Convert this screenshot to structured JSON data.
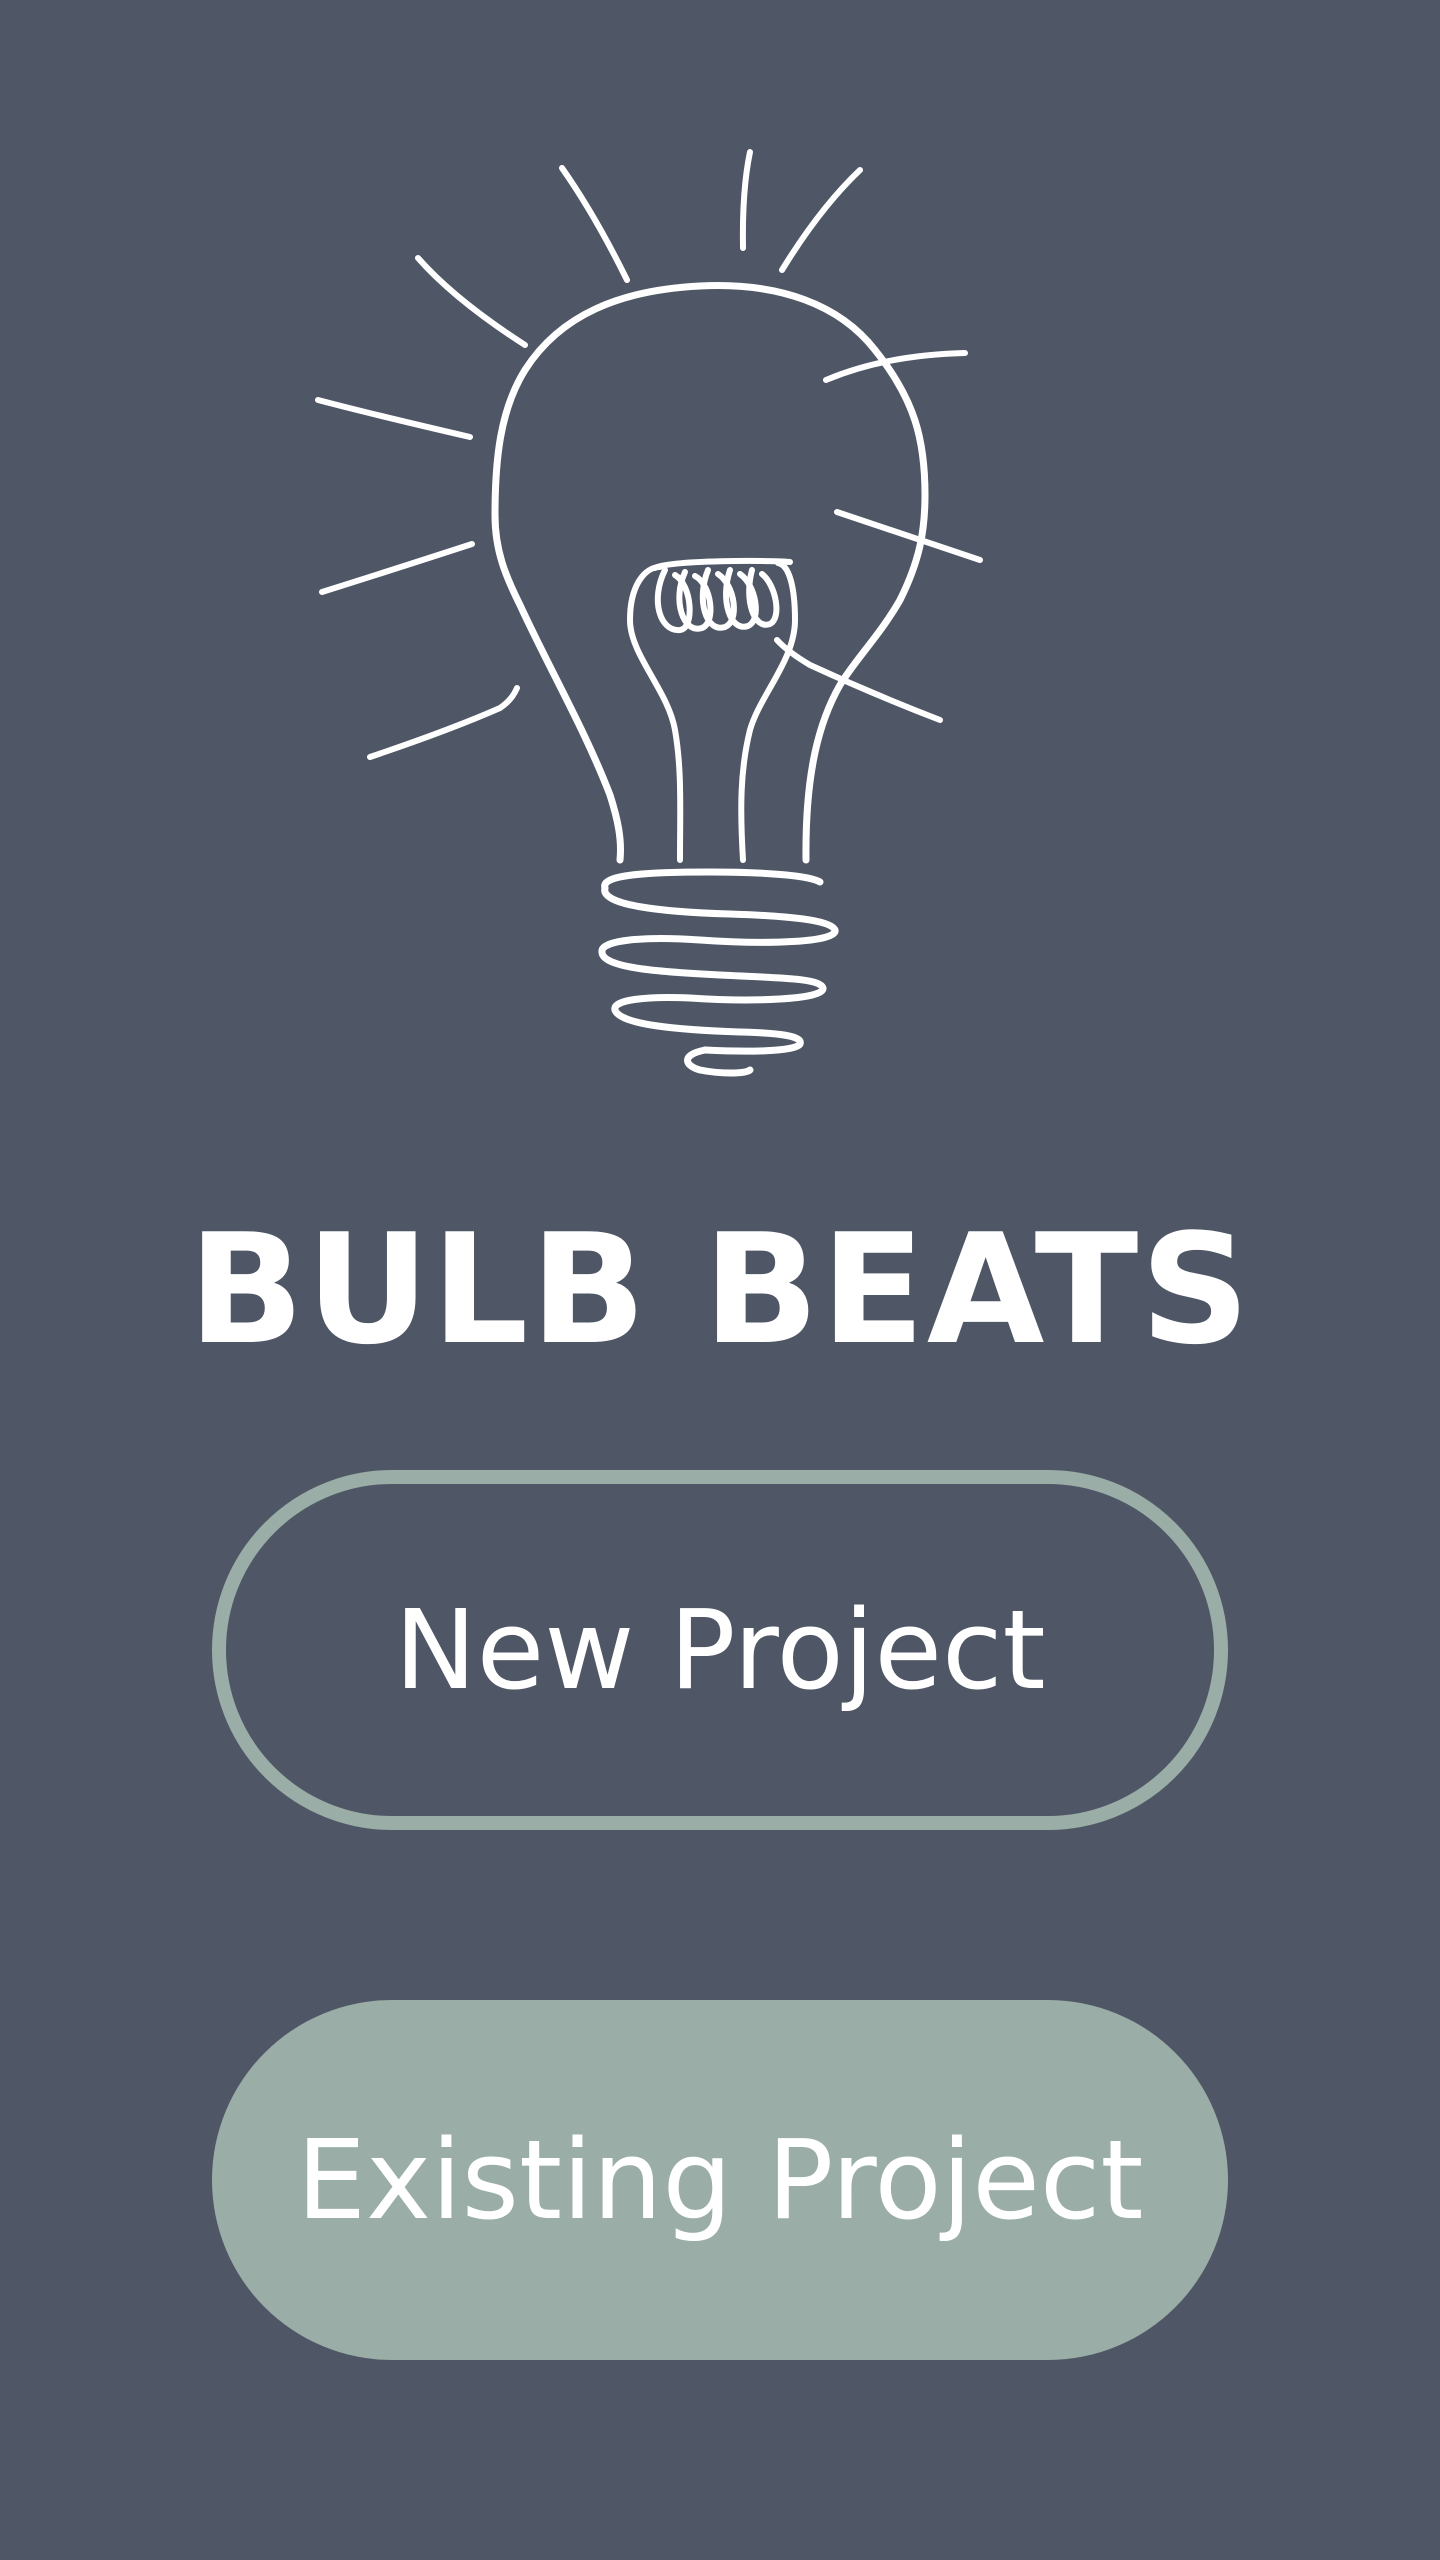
{
  "app": {
    "title": "BULB BEATS",
    "logo_icon": "lightbulb-icon"
  },
  "buttons": {
    "new_project_label": "New Project",
    "existing_project_label": "Existing Project"
  },
  "colors": {
    "background": "#4f5665",
    "accent": "#9aada6",
    "text": "#ffffff"
  }
}
